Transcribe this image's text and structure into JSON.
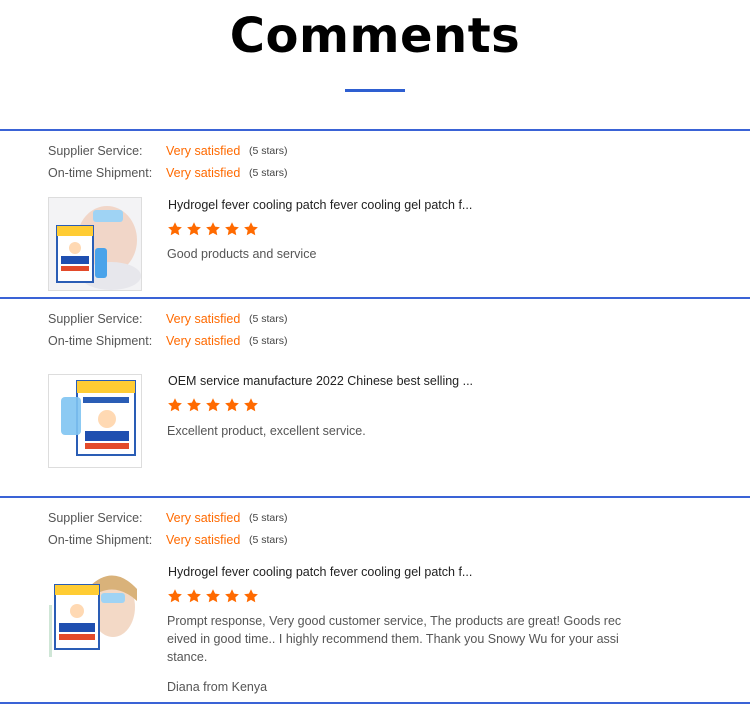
{
  "header": {
    "title": "Comments"
  },
  "colors": {
    "accent": "#2e5fd1",
    "rating_value": "#ff6a00",
    "star": "#ff6a00"
  },
  "reviews": [
    {
      "supplier_service_label": "Supplier Service:",
      "supplier_service_value": "Very satisfied",
      "supplier_service_stars": "(5 stars)",
      "shipment_label": "On-time Shipment:",
      "shipment_value": "Very satisfied",
      "shipment_stars": "(5 stars)",
      "product_title": "Hydrogel fever cooling patch fever cooling gel patch f...",
      "rating": 5,
      "comment": "Good products and service",
      "author": ""
    },
    {
      "supplier_service_label": "Supplier Service:",
      "supplier_service_value": "Very satisfied",
      "supplier_service_stars": "(5 stars)",
      "shipment_label": "On-time Shipment:",
      "shipment_value": "Very satisfied",
      "shipment_stars": "(5 stars)",
      "product_title": "OEM service manufacture 2022 Chinese best selling ...",
      "rating": 5,
      "comment": "Excellent product, excellent service.",
      "author": ""
    },
    {
      "supplier_service_label": "Supplier Service:",
      "supplier_service_value": "Very satisfied",
      "supplier_service_stars": "(5 stars)",
      "shipment_label": "On-time Shipment:",
      "shipment_value": "Very satisfied",
      "shipment_stars": "(5 stars)",
      "product_title": "Hydrogel fever cooling patch fever cooling gel patch f...",
      "rating": 5,
      "comment_lines": [
        "Prompt response, Very good customer service, The products are great! Goods rec",
        "eived in good time.. I highly recommend them. Thank you Snowy Wu for your assi",
        "stance."
      ],
      "author": "Diana from Kenya"
    }
  ]
}
